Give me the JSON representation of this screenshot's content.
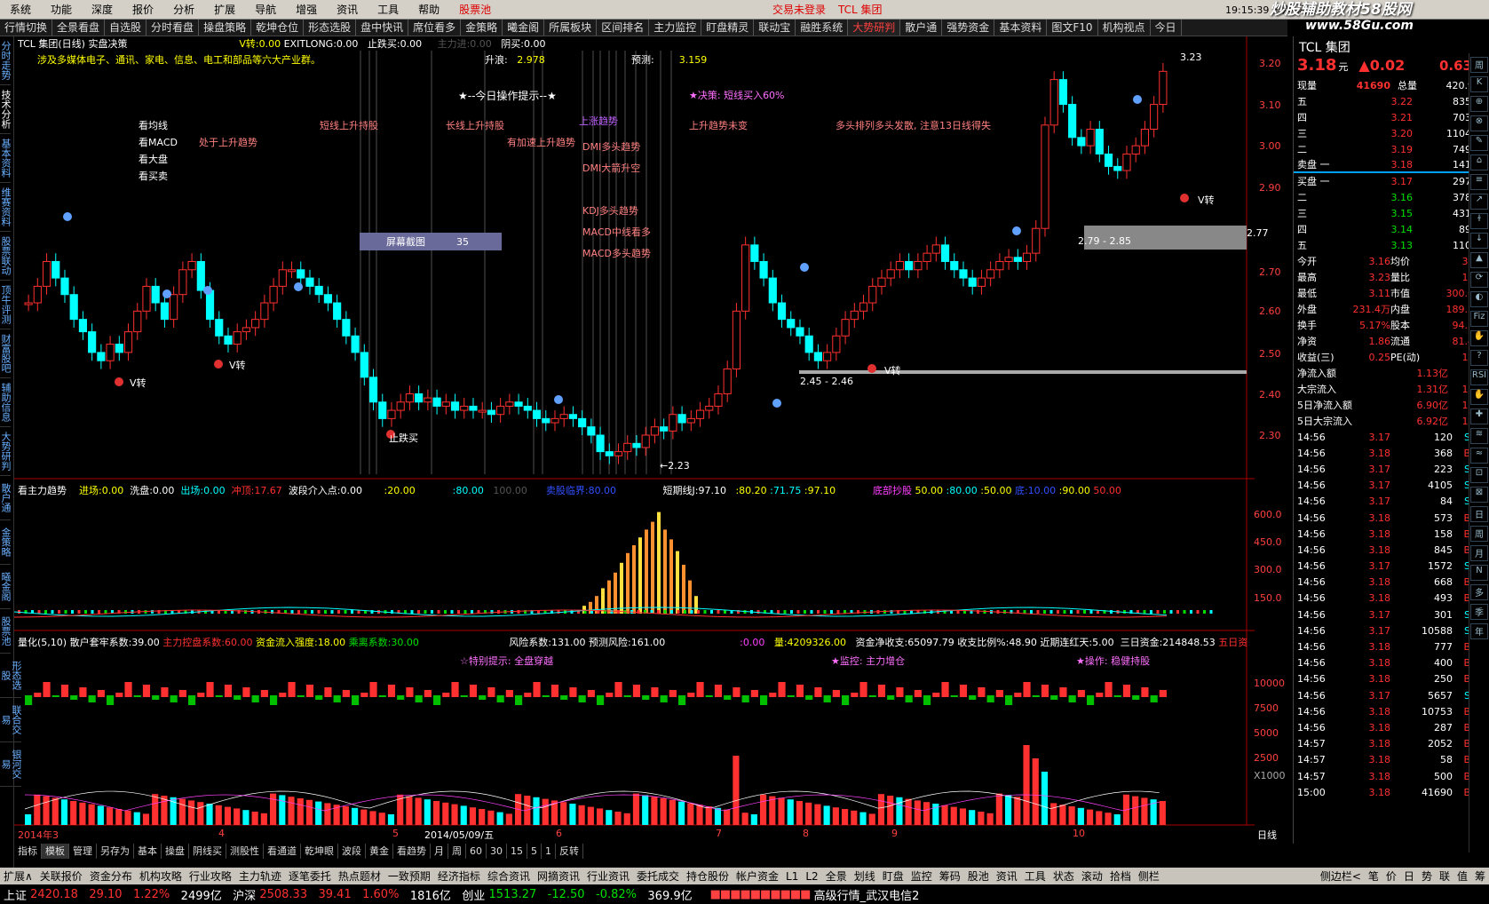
{
  "menu": {
    "items": [
      "系统",
      "功能",
      "深度",
      "报价",
      "分析",
      "扩展",
      "导航",
      "增强",
      "资讯",
      "工具",
      "帮助"
    ],
    "hl": "股票池",
    "login": "交易未登录",
    "stock": "TCL 集团",
    "time": "19:15:39 周六",
    "app": "闪电手"
  },
  "watermark": {
    "t1": "炒股辅助教材58股网",
    "t2": "www.58Gu.com"
  },
  "tabs": [
    "行情切换",
    "全景看盘",
    "自选股",
    "分时看盘",
    "操盘策略",
    "乾坤仓位",
    "形态选股",
    "盘中快讯",
    "席位看多",
    "金策略",
    "曦金阁",
    "所属板块",
    "区间排名",
    "主力监控",
    "盯盘精灵",
    "联动宝",
    "融胜系统",
    "大势研判",
    "散户通",
    "强势资金",
    "基本资料",
    "图文F10",
    "机构视点",
    "今日"
  ],
  "leftnav": [
    "分时走势",
    "技术分析",
    "基本资料",
    "维赛资料",
    "股票联动",
    "顶牛评测",
    "财富股吧",
    "辅助信息",
    "大势研判",
    "散户通",
    "金策略",
    "曦金阁",
    "股票池",
    "形态选股",
    "联合交易",
    "银河交易"
  ],
  "main": {
    "hdr1": "TCL 集团(日线) 实盘决策",
    "hdr1b": "V转:0.00",
    "hdr1c": "EXITLONG:0.00",
    "hdr1d": "止跌买:0.00",
    "hdr1e": "主力进:0.00",
    "hdr1f": "阴买:0.00",
    "desc": "涉及多媒体电子、通讯、家电、信息、电工和部品等六大产业群。",
    "rise": "升浪:",
    "riseval": "2.978",
    "pred": "预测:",
    "predval": "3.159",
    "tip": "★--今日操作提示--★",
    "decision": "★决策: 短线买入60%",
    "labels": [
      "看均线",
      "看MACD",
      "看大盘",
      "看买卖"
    ],
    "trend1": "处于上升趋势",
    "trend2": "短线上升持股",
    "trend3": "长线上升持股",
    "trend4": "有加速上升趋势",
    "trend5": "上涨趋势",
    "trend6": "上升趋势未变",
    "trend7": "多头排列多头发散, 注意13日线得失",
    "dmi1": "DMI多头趋势",
    "dmi2": "DMI大箭升空",
    "kdj": "KDJ多头趋势",
    "macd1": "MACD中线看多",
    "macd2": "MACD多头趋势",
    "vt": [
      "V转",
      "V转",
      "V转",
      "V转"
    ],
    "stop": "止跌买",
    "screenshot": "屏幕截图",
    "sc_num": "35",
    "zone1": "2.79 - 2.85",
    "zone2": "2.45 - 2.46",
    "low": "←2.23",
    "high": "3.23",
    "yaxis": [
      "3.20",
      "3.10",
      "3.00",
      "2.90",
      "2.77",
      "2.70",
      "2.60",
      "2.50",
      "2.40",
      "2.30"
    ],
    "sub1": "看主力趋势",
    "sub1b": "进场:0.00",
    "sub1c": "洗盘:0.00",
    "sub1d": "出场:0.00",
    "sub1e": "冲顶:17.67",
    "sub1f": "波段介入点:0.00",
    "sub1g": ":20.00",
    ":50": ":50.00",
    "sub1h": ":80.00",
    "sub1i": "100.00",
    "sub1j": "卖股临界:80.00",
    "sub1k": "短期线J:97.10",
    "sub1l": ":80.20",
    "sub1m": ":71.75",
    "sub1n": ":97.10",
    "sub1o": "底部抄股",
    "sub1p": "50.00",
    "sub1q": ":80.00",
    "sub1r": ":50.00",
    "sub1s": "底:10.00",
    "sub1t": ":90.00",
    "sub1u": "50.00",
    "sub1y": [
      "600.0",
      "450.0",
      "300.0",
      "150.0"
    ],
    "sub2": "量化(5,10)",
    "sub2b": "散户套牢系数:39.00",
    "sub2c": "主力控盘系数:60.00",
    "sub2d": "资金流入强度:18.00",
    "sub2e": "乘离系数:30.00",
    "sub2f": "风险系数:131.00",
    "sub2g": "预测风险:161.00",
    "sub2h": ":0.00",
    "sub2i": "量:4209326.00",
    "sub2j": "资金净收支:65097.79",
    "sub2k": "收支比例%:48.90",
    "sub2l": "近期连红天:5.00",
    "sub2m": "三日资金:214848.53",
    "sub2n": "五日资",
    "special": "☆特别提示: 全盘穿越",
    "monitor": "★监控: 主力增仓",
    "oper": "★操作: 稳健持股",
    "sub2y": [
      "10000",
      "7500",
      "5000",
      "2500",
      "X1000"
    ],
    "xdates": [
      "2014年3",
      "4",
      "5",
      "2014/05/09/五",
      "6",
      "7",
      "8",
      "9",
      "10"
    ],
    "dayline": "日线",
    "pbar": [
      "指标",
      "模板",
      "管理",
      "另存为",
      "基本",
      "操盘",
      "阴线买",
      "测股性",
      "看通道",
      "乾坤眼",
      "波段",
      "黄金",
      "看趋势",
      "月",
      "周",
      "60",
      "30",
      "15",
      "5",
      "1",
      "反转"
    ]
  },
  "quote": {
    "name": "TCL 集团",
    "price": "3.18",
    "unit": "元",
    "chg": "▲0.02",
    "pct": "0.63%",
    "now": "现量",
    "nowv": "41690",
    "tot": "总量",
    "totv": "420.9万",
    "sell": [
      [
        "五",
        "3.22",
        "83562"
      ],
      [
        "四",
        "3.21",
        "70320"
      ],
      [
        "三",
        "3.20",
        "110429"
      ],
      [
        "二",
        "3.19",
        "74918"
      ],
      [
        "卖盘 一",
        "3.18",
        "14153"
      ]
    ],
    "buy": [
      [
        "买盘 一",
        "3.17",
        "29747"
      ],
      [
        "二",
        "3.16",
        "37835"
      ],
      [
        "三",
        "3.15",
        "43115"
      ],
      [
        "四",
        "3.14",
        "8990"
      ],
      [
        "五",
        "3.13",
        "11008"
      ]
    ],
    "stats": [
      [
        "今开",
        "3.16",
        "均价",
        "3.16"
      ],
      [
        "最高",
        "3.23",
        "量比",
        "1.52"
      ],
      [
        "最低",
        "3.11",
        "市值",
        "300.6亿"
      ],
      [
        "外盘",
        "231.4万",
        "内盘",
        "189.5万"
      ],
      [
        "换手",
        "5.17%",
        "股本",
        "94.5亿"
      ],
      [
        "净资",
        "1.86",
        "流通",
        "81.4亿"
      ],
      [
        "收益(三)",
        "0.25",
        "PE(动)",
        "10.2"
      ]
    ],
    "flows": [
      [
        "净流入额",
        "1.13亿",
        "8%"
      ],
      [
        "大宗流入",
        "1.31亿",
        "10%"
      ],
      [
        "5日净流入额",
        "6.90亿",
        "14%"
      ],
      [
        "5日大宗流入",
        "6.92亿",
        "14%"
      ]
    ],
    "ticks": [
      [
        "14:56",
        "3.17",
        "120",
        "S"
      ],
      [
        "14:56",
        "3.18",
        "368",
        "B"
      ],
      [
        "14:56",
        "3.17",
        "223",
        "S"
      ],
      [
        "14:56",
        "3.17",
        "4105",
        "S"
      ],
      [
        "14:56",
        "3.17",
        "84",
        "S"
      ],
      [
        "14:56",
        "3.18",
        "573",
        "B"
      ],
      [
        "14:56",
        "3.18",
        "158",
        "B"
      ],
      [
        "14:56",
        "3.18",
        "845",
        "B"
      ],
      [
        "14:56",
        "3.17",
        "1572",
        "S"
      ],
      [
        "14:56",
        "3.18",
        "668",
        "B"
      ],
      [
        "14:56",
        "3.18",
        "493",
        "B"
      ],
      [
        "14:56",
        "3.17",
        "301",
        "S"
      ],
      [
        "14:56",
        "3.17",
        "10588",
        "S"
      ],
      [
        "14:56",
        "3.18",
        "777",
        "B"
      ],
      [
        "14:56",
        "3.18",
        "400",
        "B"
      ],
      [
        "14:56",
        "3.18",
        "250",
        "B"
      ],
      [
        "14:56",
        "3.17",
        "5657",
        "S"
      ],
      [
        "14:56",
        "3.18",
        "10753",
        "B"
      ],
      [
        "14:56",
        "3.18",
        "287",
        "B"
      ],
      [
        "14:57",
        "3.18",
        "2052",
        "B"
      ],
      [
        "14:57",
        "3.18",
        "58",
        "B"
      ],
      [
        "14:57",
        "3.18",
        "500",
        "B"
      ],
      [
        "15:00",
        "3.18",
        "41690",
        "B"
      ]
    ]
  },
  "icons": [
    "周",
    "K",
    "⊕",
    "⊗",
    "✎",
    "⌂",
    "≡",
    "↗",
    "ɫ",
    "↓",
    "▲",
    "⟳",
    "◐",
    "Fiz",
    "✋",
    "?",
    "RSI",
    "✋",
    "✚",
    "≋",
    "≈",
    "⊡",
    "⊠",
    "日",
    "周",
    "月",
    "N",
    "多",
    "季",
    "年"
  ],
  "bottom1": [
    "扩展∧",
    "关联报价",
    "资金分布",
    "机构攻略",
    "行业攻略",
    "主力轨迹",
    "逐笔委托",
    "热点题材",
    "一致预期",
    "经济指标",
    "综合资讯",
    "网摘资讯",
    "行业资讯",
    "委托成交",
    "持仓股份",
    "帐户资金",
    "L1",
    "L2",
    "全景",
    "划线",
    "盯盘",
    "监控",
    "筹码",
    "股池",
    "资讯",
    "工具",
    "状态",
    "滚动",
    "拾档",
    "侧栏"
  ],
  "bottom1r": [
    "侧边栏<",
    "笔",
    "价",
    "日",
    "势",
    "联",
    "值",
    "筹"
  ],
  "bottom2": {
    "sh": "上证",
    "shv": "2420.18",
    "shc": "29.10",
    "shp": "1.22%",
    "sha": "2499亿",
    "sz": "沪深",
    "szv": "2508.33",
    "szc": "39.41",
    "szp": "1.60%",
    "sza": "1816亿",
    "cy": "创业",
    "cyv": "1513.27",
    "cyc": "-12.50",
    "cyp": "-0.82%",
    "cya": "369.9亿",
    "news": "高级行情_武汉电信2"
  }
}
